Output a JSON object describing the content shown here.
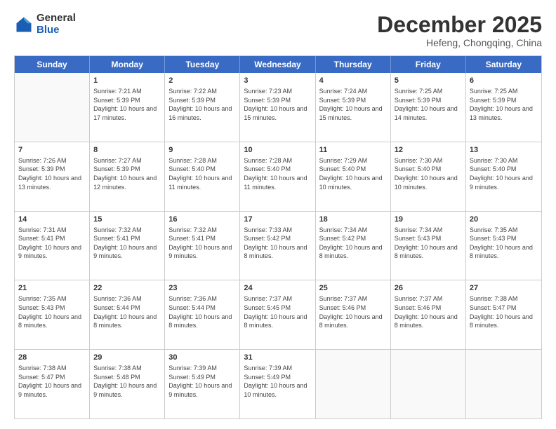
{
  "header": {
    "logo_general": "General",
    "logo_blue": "Blue",
    "month_title": "December 2025",
    "subtitle": "Hefeng, Chongqing, China"
  },
  "calendar": {
    "days": [
      "Sunday",
      "Monday",
      "Tuesday",
      "Wednesday",
      "Thursday",
      "Friday",
      "Saturday"
    ],
    "rows": [
      [
        {
          "day": "",
          "info": ""
        },
        {
          "day": "1",
          "info": "Sunrise: 7:21 AM\nSunset: 5:39 PM\nDaylight: 10 hours and 17 minutes."
        },
        {
          "day": "2",
          "info": "Sunrise: 7:22 AM\nSunset: 5:39 PM\nDaylight: 10 hours and 16 minutes."
        },
        {
          "day": "3",
          "info": "Sunrise: 7:23 AM\nSunset: 5:39 PM\nDaylight: 10 hours and 15 minutes."
        },
        {
          "day": "4",
          "info": "Sunrise: 7:24 AM\nSunset: 5:39 PM\nDaylight: 10 hours and 15 minutes."
        },
        {
          "day": "5",
          "info": "Sunrise: 7:25 AM\nSunset: 5:39 PM\nDaylight: 10 hours and 14 minutes."
        },
        {
          "day": "6",
          "info": "Sunrise: 7:25 AM\nSunset: 5:39 PM\nDaylight: 10 hours and 13 minutes."
        }
      ],
      [
        {
          "day": "7",
          "info": "Sunrise: 7:26 AM\nSunset: 5:39 PM\nDaylight: 10 hours and 13 minutes."
        },
        {
          "day": "8",
          "info": "Sunrise: 7:27 AM\nSunset: 5:39 PM\nDaylight: 10 hours and 12 minutes."
        },
        {
          "day": "9",
          "info": "Sunrise: 7:28 AM\nSunset: 5:40 PM\nDaylight: 10 hours and 11 minutes."
        },
        {
          "day": "10",
          "info": "Sunrise: 7:28 AM\nSunset: 5:40 PM\nDaylight: 10 hours and 11 minutes."
        },
        {
          "day": "11",
          "info": "Sunrise: 7:29 AM\nSunset: 5:40 PM\nDaylight: 10 hours and 10 minutes."
        },
        {
          "day": "12",
          "info": "Sunrise: 7:30 AM\nSunset: 5:40 PM\nDaylight: 10 hours and 10 minutes."
        },
        {
          "day": "13",
          "info": "Sunrise: 7:30 AM\nSunset: 5:40 PM\nDaylight: 10 hours and 9 minutes."
        }
      ],
      [
        {
          "day": "14",
          "info": "Sunrise: 7:31 AM\nSunset: 5:41 PM\nDaylight: 10 hours and 9 minutes."
        },
        {
          "day": "15",
          "info": "Sunrise: 7:32 AM\nSunset: 5:41 PM\nDaylight: 10 hours and 9 minutes."
        },
        {
          "day": "16",
          "info": "Sunrise: 7:32 AM\nSunset: 5:41 PM\nDaylight: 10 hours and 9 minutes."
        },
        {
          "day": "17",
          "info": "Sunrise: 7:33 AM\nSunset: 5:42 PM\nDaylight: 10 hours and 8 minutes."
        },
        {
          "day": "18",
          "info": "Sunrise: 7:34 AM\nSunset: 5:42 PM\nDaylight: 10 hours and 8 minutes."
        },
        {
          "day": "19",
          "info": "Sunrise: 7:34 AM\nSunset: 5:43 PM\nDaylight: 10 hours and 8 minutes."
        },
        {
          "day": "20",
          "info": "Sunrise: 7:35 AM\nSunset: 5:43 PM\nDaylight: 10 hours and 8 minutes."
        }
      ],
      [
        {
          "day": "21",
          "info": "Sunrise: 7:35 AM\nSunset: 5:43 PM\nDaylight: 10 hours and 8 minutes."
        },
        {
          "day": "22",
          "info": "Sunrise: 7:36 AM\nSunset: 5:44 PM\nDaylight: 10 hours and 8 minutes."
        },
        {
          "day": "23",
          "info": "Sunrise: 7:36 AM\nSunset: 5:44 PM\nDaylight: 10 hours and 8 minutes."
        },
        {
          "day": "24",
          "info": "Sunrise: 7:37 AM\nSunset: 5:45 PM\nDaylight: 10 hours and 8 minutes."
        },
        {
          "day": "25",
          "info": "Sunrise: 7:37 AM\nSunset: 5:46 PM\nDaylight: 10 hours and 8 minutes."
        },
        {
          "day": "26",
          "info": "Sunrise: 7:37 AM\nSunset: 5:46 PM\nDaylight: 10 hours and 8 minutes."
        },
        {
          "day": "27",
          "info": "Sunrise: 7:38 AM\nSunset: 5:47 PM\nDaylight: 10 hours and 8 minutes."
        }
      ],
      [
        {
          "day": "28",
          "info": "Sunrise: 7:38 AM\nSunset: 5:47 PM\nDaylight: 10 hours and 9 minutes."
        },
        {
          "day": "29",
          "info": "Sunrise: 7:38 AM\nSunset: 5:48 PM\nDaylight: 10 hours and 9 minutes."
        },
        {
          "day": "30",
          "info": "Sunrise: 7:39 AM\nSunset: 5:49 PM\nDaylight: 10 hours and 9 minutes."
        },
        {
          "day": "31",
          "info": "Sunrise: 7:39 AM\nSunset: 5:49 PM\nDaylight: 10 hours and 10 minutes."
        },
        {
          "day": "",
          "info": ""
        },
        {
          "day": "",
          "info": ""
        },
        {
          "day": "",
          "info": ""
        }
      ]
    ]
  }
}
